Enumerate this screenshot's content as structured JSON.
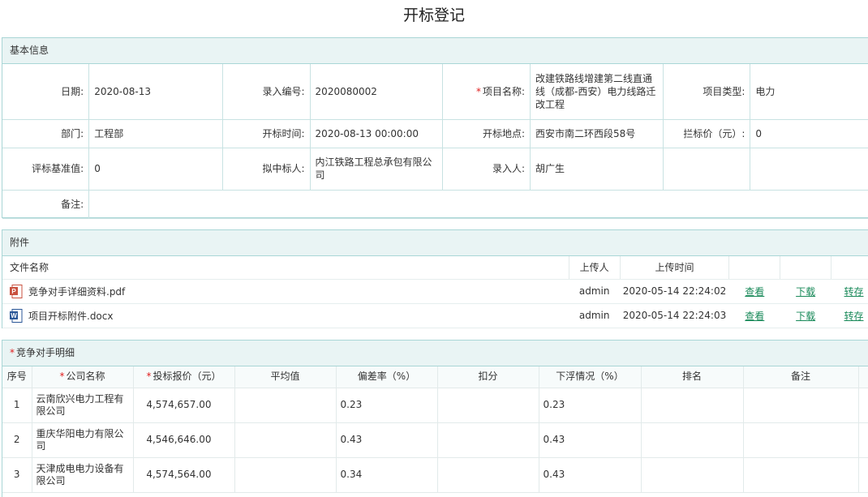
{
  "page_title": "开标登记",
  "basic": {
    "section_title": "基本信息",
    "date_label": "日期:",
    "date_value": "2020-08-13",
    "entry_no_label": "录入编号:",
    "entry_no_value": "2020080002",
    "project_name_label": "项目名称:",
    "project_name_value": "改建铁路线增建第二线直通线（成都-西安）电力线路迁改工程",
    "project_type_label": "项目类型:",
    "project_type_value": "电力",
    "dept_label": "部门:",
    "dept_value": "工程部",
    "open_time_label": "开标时间:",
    "open_time_value": "2020-08-13 00:00:00",
    "open_place_label": "开标地点:",
    "open_place_value": "西安市南二环西段58号",
    "bid_price_label": "拦标价（元）:",
    "bid_price_value": "0",
    "eval_base_label": "评标基准值:",
    "eval_base_value": "0",
    "winner_label": "拟中标人:",
    "winner_value": "内江铁路工程总承包有限公司",
    "entry_person_label": "录入人:",
    "entry_person_value": "胡广生",
    "remark_label": "备注:",
    "remark_value": ""
  },
  "attachments": {
    "section_title": "附件",
    "col_file": "文件名称",
    "col_uploader": "上传人",
    "col_time": "上传时间",
    "files": [
      {
        "name": "竞争对手详细资料.pdf",
        "icon": "pdf-icon",
        "uploader": "admin",
        "time": "2020-05-14 22:24:02",
        "view": "查看",
        "download": "下载",
        "save": "转存"
      },
      {
        "name": "项目开标附件.docx",
        "icon": "word-icon",
        "uploader": "admin",
        "time": "2020-05-14 22:24:03",
        "view": "查看",
        "download": "下载",
        "save": "转存"
      }
    ]
  },
  "competitors": {
    "section_title": "竞争对手明细",
    "headers": {
      "seq": "序号",
      "company": "公司名称",
      "price": "投标报价（元）",
      "avg": "平均值",
      "deviation": "偏差率（%）",
      "deduct": "扣分",
      "float": "下浮情况（%）",
      "rank": "排名",
      "remark": "备注"
    },
    "rows": [
      {
        "seq": "1",
        "company": "云南欣兴电力工程有限公司",
        "price": "4,574,657.00",
        "avg": "",
        "deviation": "0.23",
        "deduct": "",
        "float": "0.23",
        "rank": "",
        "remark": ""
      },
      {
        "seq": "2",
        "company": "重庆华阳电力有限公司",
        "price": "4,546,646.00",
        "avg": "",
        "deviation": "0.43",
        "deduct": "",
        "float": "0.43",
        "rank": "",
        "remark": ""
      },
      {
        "seq": "3",
        "company": "天津成电电力设备有限公司",
        "price": "4,574,564.00",
        "avg": "",
        "deviation": "0.34",
        "deduct": "",
        "float": "0.43",
        "rank": "",
        "remark": ""
      }
    ]
  },
  "colors": {
    "accent_border": "#a9d6d6",
    "panel_head": "#e9f4f4",
    "link": "#1a8a5a",
    "required": "#e02020"
  }
}
